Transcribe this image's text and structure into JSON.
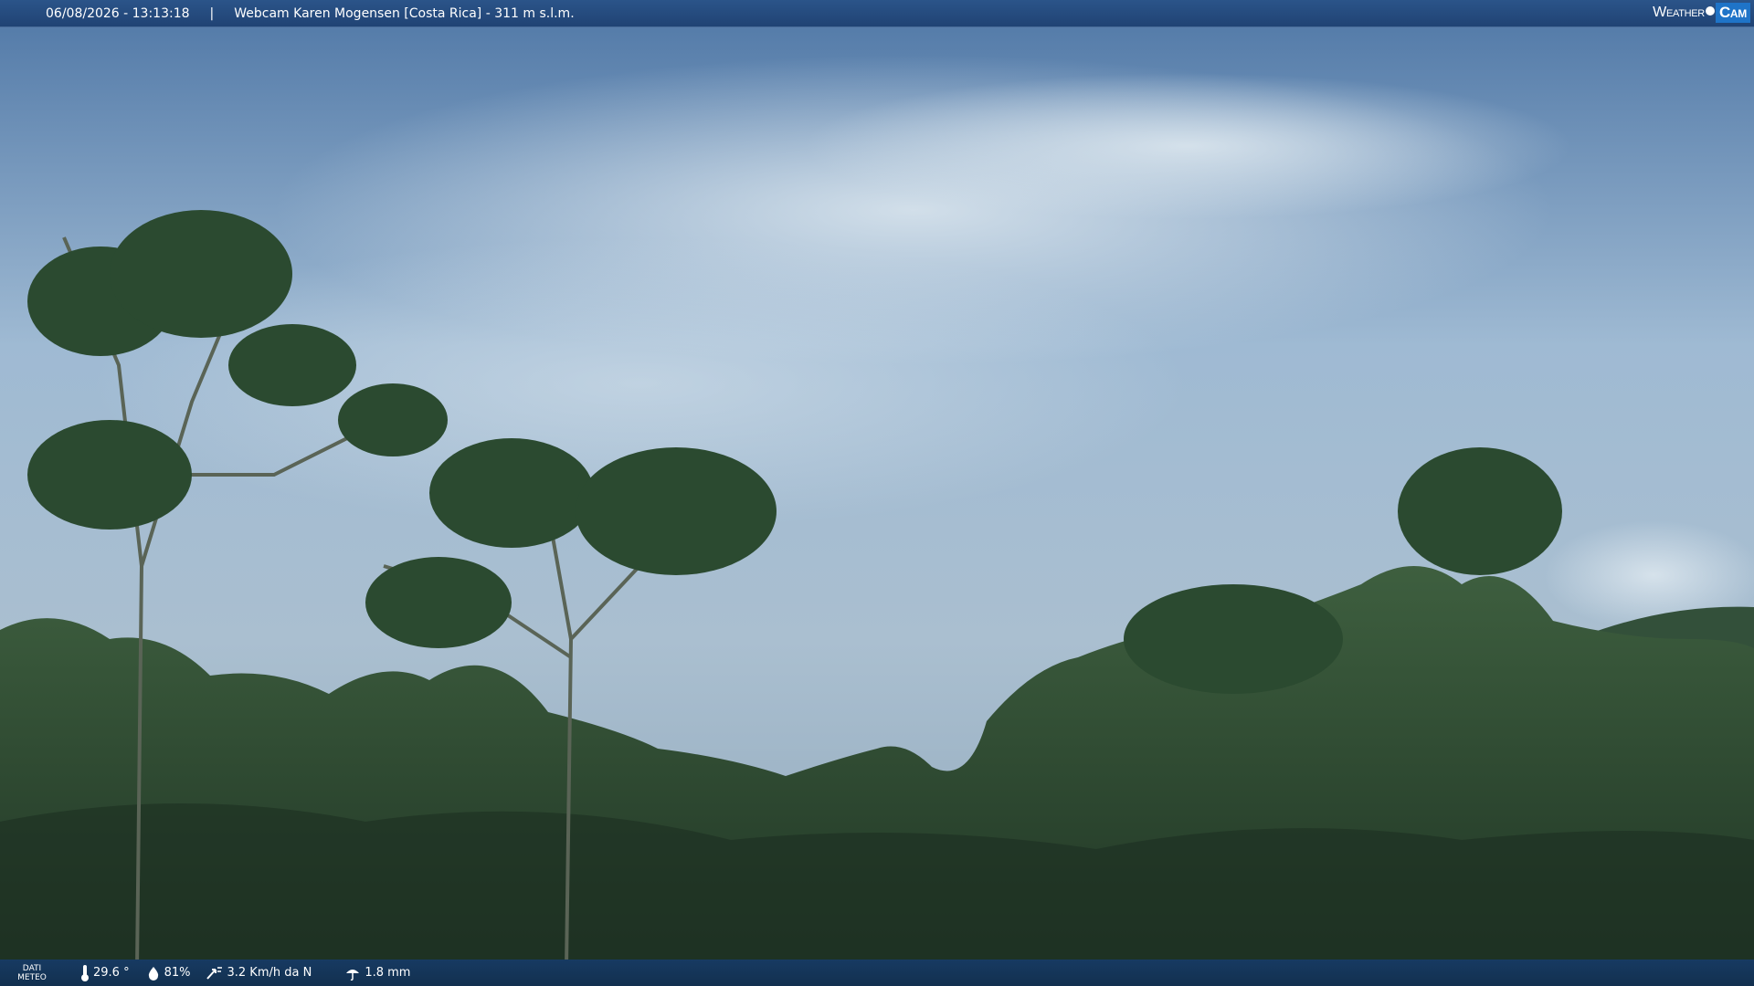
{
  "header": {
    "timestamp": "06/08/2026 - 13:13:18",
    "separator": "|",
    "title": "Webcam Karen Mogensen [Costa Rica] - 311 m s.l.m.",
    "logo_left": "Weather",
    "logo_right": "Cam"
  },
  "footer": {
    "label_line1": "DATI",
    "label_line2": "METEO",
    "temperature": "29.6 °",
    "humidity": "81%",
    "wind": "3.2 Km/h da N",
    "rain": "1.8 mm",
    "icons": [
      "thermometer-icon",
      "humidity-drop-icon",
      "wind-icon",
      "rain-icon"
    ]
  },
  "colors": {
    "topbar": "#204374",
    "bottombar": "#12304f",
    "sky": "#9fb8cc",
    "foliage": "#2f4a35"
  }
}
